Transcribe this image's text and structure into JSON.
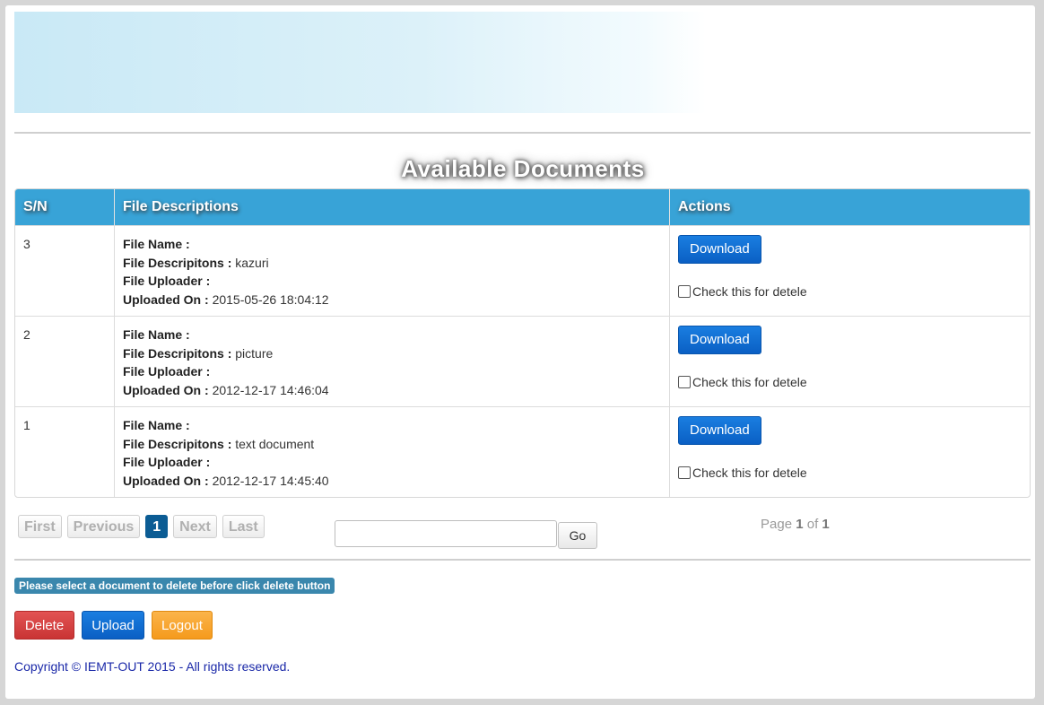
{
  "page": {
    "title": "Available Documents"
  },
  "table": {
    "headers": [
      "S/N",
      "File Descriptions",
      "Actions"
    ],
    "labels": {
      "file_name": "File Name :",
      "file_desc": "File Descripitons :",
      "file_uploader": "File Uploader :",
      "uploaded_on": "Uploaded On :"
    },
    "download_label": "Download",
    "checkbox_label": "Check this for detele",
    "rows": [
      {
        "sn": "3",
        "file_name": "",
        "description": "kazuri",
        "uploader": "",
        "uploaded_on": "2015-05-26 18:04:12"
      },
      {
        "sn": "2",
        "file_name": "",
        "description": "picture",
        "uploader": "",
        "uploaded_on": "2012-12-17 14:46:04"
      },
      {
        "sn": "1",
        "file_name": "",
        "description": "text document",
        "uploader": "",
        "uploaded_on": "2012-12-17 14:45:40"
      }
    ]
  },
  "pager": {
    "first": "First",
    "previous": "Previous",
    "current": "1",
    "next": "Next",
    "last": "Last",
    "go_label": "Go",
    "page_word": "Page",
    "of_word": "of",
    "page_current": "1",
    "page_total": "1"
  },
  "notice": "Please select a document to delete before click delete button",
  "actions": {
    "delete": "Delete",
    "upload": "Upload",
    "logout": "Logout"
  },
  "footer": "Copyright © IEMT-OUT 2015 - All rights reserved.",
  "colors": {
    "header_bg": "#38a3d7",
    "primary": "#0a5fc4",
    "danger": "#c93434",
    "warning": "#f59a1c",
    "info": "#3a87ad",
    "footer_text": "#1a28a8"
  }
}
